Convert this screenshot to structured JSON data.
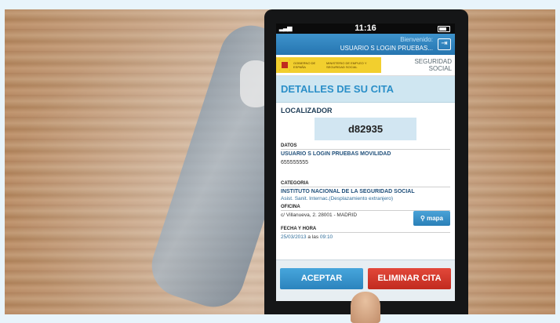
{
  "status_bar": {
    "time": "11:16"
  },
  "header": {
    "greeting": "Bienvenido:",
    "user": "USUARIO S LOGIN PRUEBAS...",
    "logout_icon": "logout-icon"
  },
  "branding": {
    "gov_line1": "GOBIERNO DE ESPAÑA",
    "gov_line2": "MINISTERIO DE EMPLEO Y SEGURIDAD SOCIAL",
    "ss_line1": "SEGURIDAD",
    "ss_line2": "SOCIAL"
  },
  "page": {
    "title": "DETALLES DE SU CITA"
  },
  "localizador": {
    "label": "LOCALIZADOR",
    "value": "d82935"
  },
  "datos": {
    "label": "DATOS",
    "name": "USUARIO S LOGIN PRUEBAS MOVILIDAD",
    "phone": "655555555"
  },
  "categoria": {
    "label": "CATEGORIA",
    "name": "INSTITUTO NACIONAL DE LA SEGURIDAD SOCIAL",
    "detail": "Asist. Sanit. Internac.(Desplazamiento extranjero)"
  },
  "oficina": {
    "label": "OFICINA",
    "address": "c/ Villanueva, 2. 28001 - MADRID",
    "map_button": "mapa"
  },
  "fecha": {
    "label": "FECHA Y HORA",
    "date": "25/03/2013",
    "connector": "a las",
    "time": "09:10"
  },
  "actions": {
    "accept": "ACEPTAR",
    "delete": "ELIMINAR CITA"
  },
  "colors": {
    "accent": "#2b8fc8",
    "delete": "#c12a1f",
    "header_bg": "#cfe6f1"
  }
}
